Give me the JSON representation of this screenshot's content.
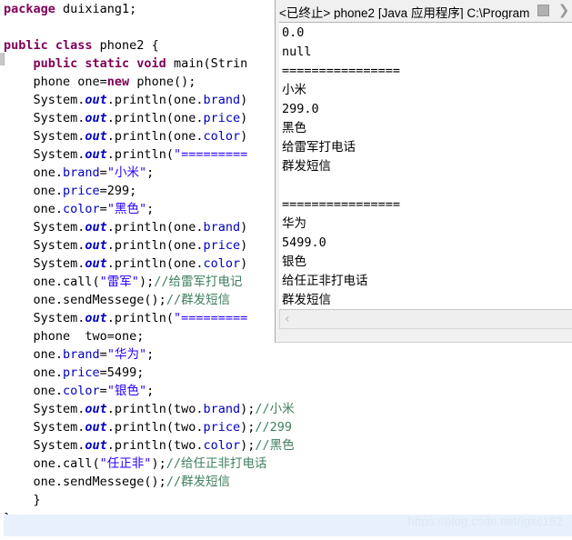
{
  "editor": {
    "language": "java",
    "code_lines": [
      [
        {
          "t": "package ",
          "c": "kw"
        },
        {
          "t": "duixiang1;",
          "c": "pl"
        }
      ],
      [],
      [
        {
          "t": "public class ",
          "c": "kw"
        },
        {
          "t": "phone2 {",
          "c": "pl"
        }
      ],
      [
        {
          "t": "    ",
          "c": "pl"
        },
        {
          "t": "public static void ",
          "c": "kw"
        },
        {
          "t": "main(Strin",
          "c": "pl"
        }
      ],
      [
        {
          "t": "    phone one=",
          "c": "pl"
        },
        {
          "t": "new ",
          "c": "kw"
        },
        {
          "t": "phone();",
          "c": "pl"
        }
      ],
      [
        {
          "t": "    System.",
          "c": "pl"
        },
        {
          "t": "out",
          "c": "sfld"
        },
        {
          "t": ".println(one.",
          "c": "pl"
        },
        {
          "t": "brand",
          "c": "fld"
        },
        {
          "t": ")",
          "c": "pl"
        }
      ],
      [
        {
          "t": "    System.",
          "c": "pl"
        },
        {
          "t": "out",
          "c": "sfld"
        },
        {
          "t": ".println(one.",
          "c": "pl"
        },
        {
          "t": "price",
          "c": "fld"
        },
        {
          "t": ")",
          "c": "pl"
        }
      ],
      [
        {
          "t": "    System.",
          "c": "pl"
        },
        {
          "t": "out",
          "c": "sfld"
        },
        {
          "t": ".println(one.",
          "c": "pl"
        },
        {
          "t": "color",
          "c": "fld"
        },
        {
          "t": ")",
          "c": "pl"
        }
      ],
      [
        {
          "t": "    System.",
          "c": "pl"
        },
        {
          "t": "out",
          "c": "sfld"
        },
        {
          "t": ".println(",
          "c": "pl"
        },
        {
          "t": "\"=========",
          "c": "str"
        }
      ],
      [
        {
          "t": "    one.",
          "c": "pl"
        },
        {
          "t": "brand",
          "c": "fld"
        },
        {
          "t": "=",
          "c": "pl"
        },
        {
          "t": "\"小米\"",
          "c": "str"
        },
        {
          "t": ";",
          "c": "pl"
        }
      ],
      [
        {
          "t": "    one.",
          "c": "pl"
        },
        {
          "t": "price",
          "c": "fld"
        },
        {
          "t": "=299;",
          "c": "pl"
        }
      ],
      [
        {
          "t": "    one.",
          "c": "pl"
        },
        {
          "t": "color",
          "c": "fld"
        },
        {
          "t": "=",
          "c": "pl"
        },
        {
          "t": "\"黑色\"",
          "c": "str"
        },
        {
          "t": ";",
          "c": "pl"
        }
      ],
      [
        {
          "t": "    System.",
          "c": "pl"
        },
        {
          "t": "out",
          "c": "sfld"
        },
        {
          "t": ".println(one.",
          "c": "pl"
        },
        {
          "t": "brand",
          "c": "fld"
        },
        {
          "t": ")",
          "c": "pl"
        }
      ],
      [
        {
          "t": "    System.",
          "c": "pl"
        },
        {
          "t": "out",
          "c": "sfld"
        },
        {
          "t": ".println(one.",
          "c": "pl"
        },
        {
          "t": "price",
          "c": "fld"
        },
        {
          "t": ")",
          "c": "pl"
        }
      ],
      [
        {
          "t": "    System.",
          "c": "pl"
        },
        {
          "t": "out",
          "c": "sfld"
        },
        {
          "t": ".println(one.",
          "c": "pl"
        },
        {
          "t": "color",
          "c": "fld"
        },
        {
          "t": ")",
          "c": "pl"
        }
      ],
      [
        {
          "t": "    one.call(",
          "c": "pl"
        },
        {
          "t": "\"雷军\"",
          "c": "str"
        },
        {
          "t": ");",
          "c": "pl"
        },
        {
          "t": "//给雷军打电记",
          "c": "cmt"
        }
      ],
      [
        {
          "t": "    one.sendMessege();",
          "c": "pl"
        },
        {
          "t": "//群发短信",
          "c": "cmt"
        }
      ],
      [
        {
          "t": "    System.",
          "c": "pl"
        },
        {
          "t": "out",
          "c": "sfld"
        },
        {
          "t": ".println(",
          "c": "pl"
        },
        {
          "t": "\"=========",
          "c": "str"
        }
      ],
      [
        {
          "t": "    phone  two=one;",
          "c": "pl"
        }
      ],
      [
        {
          "t": "    one.",
          "c": "pl"
        },
        {
          "t": "brand",
          "c": "fld"
        },
        {
          "t": "=",
          "c": "pl"
        },
        {
          "t": "\"华为\"",
          "c": "str"
        },
        {
          "t": ";",
          "c": "pl"
        }
      ],
      [
        {
          "t": "    one.",
          "c": "pl"
        },
        {
          "t": "price",
          "c": "fld"
        },
        {
          "t": "=5499;",
          "c": "pl"
        }
      ],
      [
        {
          "t": "    one.",
          "c": "pl"
        },
        {
          "t": "color",
          "c": "fld"
        },
        {
          "t": "=",
          "c": "pl"
        },
        {
          "t": "\"银色\"",
          "c": "str"
        },
        {
          "t": ";",
          "c": "pl"
        }
      ],
      [
        {
          "t": "    System.",
          "c": "pl"
        },
        {
          "t": "out",
          "c": "sfld"
        },
        {
          "t": ".println(two.",
          "c": "pl"
        },
        {
          "t": "brand",
          "c": "fld"
        },
        {
          "t": ");",
          "c": "pl"
        },
        {
          "t": "//小米",
          "c": "cmt"
        }
      ],
      [
        {
          "t": "    System.",
          "c": "pl"
        },
        {
          "t": "out",
          "c": "sfld"
        },
        {
          "t": ".println(two.",
          "c": "pl"
        },
        {
          "t": "price",
          "c": "fld"
        },
        {
          "t": ");",
          "c": "pl"
        },
        {
          "t": "//299",
          "c": "cmt"
        }
      ],
      [
        {
          "t": "    System.",
          "c": "pl"
        },
        {
          "t": "out",
          "c": "sfld"
        },
        {
          "t": ".println(two.",
          "c": "pl"
        },
        {
          "t": "color",
          "c": "fld"
        },
        {
          "t": ");",
          "c": "pl"
        },
        {
          "t": "//黑色",
          "c": "cmt"
        }
      ],
      [
        {
          "t": "    one.call(",
          "c": "pl"
        },
        {
          "t": "\"任正非\"",
          "c": "str"
        },
        {
          "t": ");",
          "c": "pl"
        },
        {
          "t": "//给任正非打电话",
          "c": "cmt"
        }
      ],
      [
        {
          "t": "    one.sendMessege();",
          "c": "pl"
        },
        {
          "t": "//群发短信",
          "c": "cmt"
        }
      ],
      [
        {
          "t": "    }",
          "c": "pl"
        }
      ],
      [
        {
          "t": "}",
          "c": "pl"
        }
      ]
    ]
  },
  "console": {
    "title": "<已终止> phone2 [Java 应用程序] C:\\Program",
    "toolbar": {
      "stop_label": "terminate",
      "next_label": "more"
    },
    "output_lines": [
      "0.0",
      "null",
      "================",
      "小米",
      "299.0",
      "黑色",
      "给雷军打电话",
      "群发短信",
      "",
      "================",
      "华为",
      "5499.0",
      "银色",
      "给任正非打电话",
      "群发短信"
    ],
    "hscroll": {
      "left_arrow": "‹"
    }
  },
  "watermark": {
    "text": "https://blog.csdn.net/jgxc152"
  },
  "colors": {
    "keyword": "#7f0055",
    "string": "#2a00ff",
    "comment": "#3f7f5f",
    "field": "#0000c0",
    "console_bg": "#f0f0f0",
    "editor_bg": "#ffffff",
    "current_line": "#e8f0fc",
    "watermark": "#dce7f5"
  }
}
